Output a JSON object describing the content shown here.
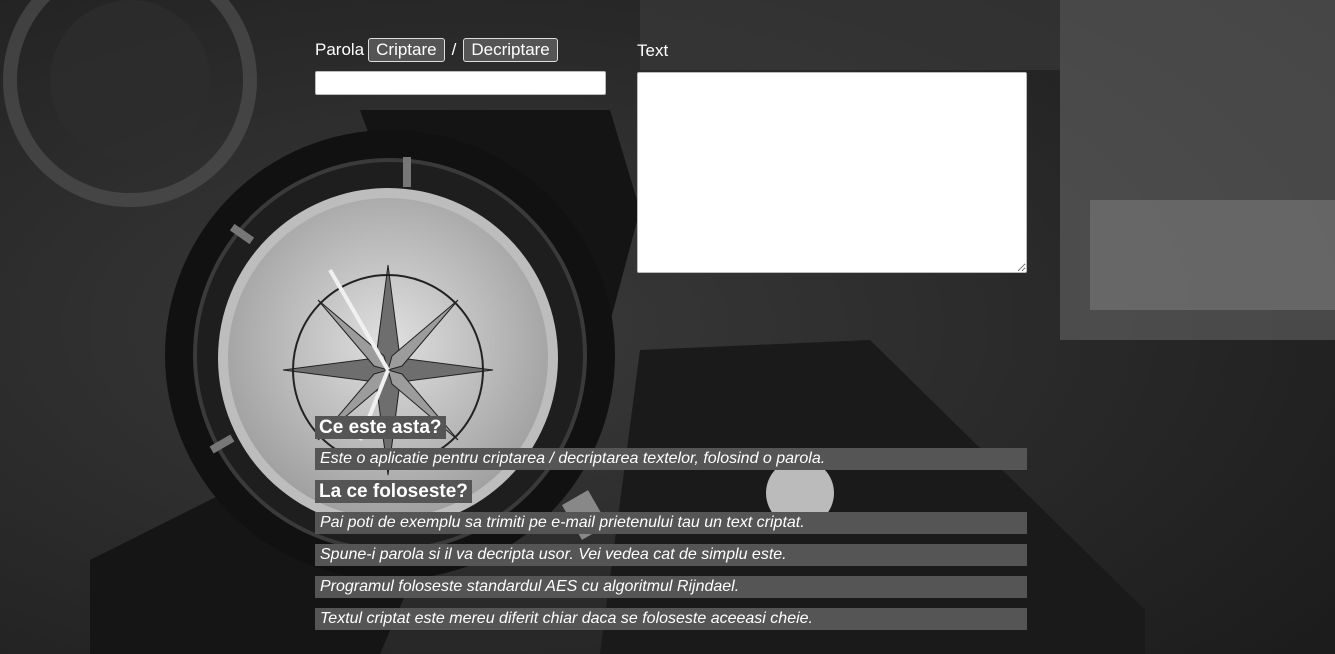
{
  "form": {
    "password_label": "Parola",
    "encrypt_label": "Criptare",
    "separator": "/",
    "decrypt_label": "Decriptare",
    "password_value": "",
    "text_label": "Text",
    "text_value": ""
  },
  "info": {
    "heading1": "Ce este asta?",
    "p1": "Este o aplicatie pentru criptarea / decriptarea textelor, folosind o parola.",
    "heading2": "La ce foloseste?",
    "p2": "Pai poti de exemplu sa trimiti pe e-mail prietenului tau un text criptat.",
    "p3": "Spune-i parola si il va decripta usor. Vei vedea cat de simplu este.",
    "p4": "Programul foloseste standardul AES cu algoritmul Rijndael.",
    "p5": "Textul criptat este mereu diferit chiar daca se foloseste aceeasi cheie."
  },
  "colors": {
    "panel": "#555555",
    "text": "#ffffff"
  },
  "background_image": "grayscale photo of a wristwatch"
}
